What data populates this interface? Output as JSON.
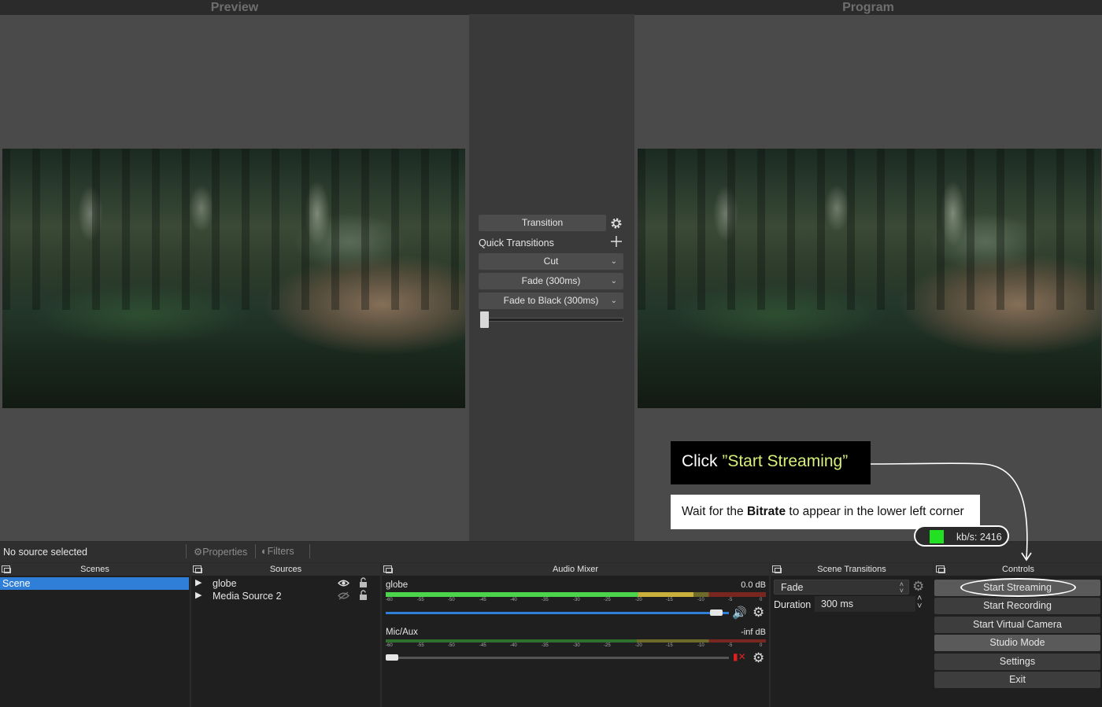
{
  "preview": {
    "title": "Preview"
  },
  "program": {
    "title": "Program"
  },
  "transition_panel": {
    "transition_label": "Transition",
    "quick_transitions_label": "Quick Transitions",
    "quick_items": [
      "Cut",
      "Fade (300ms)",
      "Fade to Black (300ms)"
    ],
    "tbar_position": 0
  },
  "status": {
    "no_source": "No source selected",
    "properties": "Properties",
    "filters": "Filters"
  },
  "scenes": {
    "title": "Scenes",
    "items": [
      "Scene"
    ],
    "selected": "Scene"
  },
  "sources": {
    "title": "Sources",
    "items": [
      {
        "name": "globe",
        "visible": true
      },
      {
        "name": "Media Source 2",
        "visible": false
      }
    ]
  },
  "audio_mixer": {
    "title": "Audio Mixer",
    "tick_labels": [
      "-60",
      "-55",
      "-50",
      "-45",
      "-40",
      "-35",
      "-30",
      "-25",
      "-20",
      "-15",
      "-10",
      "-5",
      "0"
    ],
    "channels": [
      {
        "name": "globe",
        "db": "0.0 dB",
        "volume_fraction": 0.98,
        "muted": false
      },
      {
        "name": "Mic/Aux",
        "db": "-inf dB",
        "volume_fraction": 0.0,
        "muted": true
      }
    ]
  },
  "scene_transitions": {
    "title": "Scene Transitions",
    "selected": "Fade",
    "duration_label": "Duration",
    "duration_value": "300 ms"
  },
  "controls": {
    "title": "Controls",
    "buttons": [
      "Start Streaming",
      "Start Recording",
      "Start Virtual Camera",
      "Studio Mode",
      "Settings",
      "Exit"
    ]
  },
  "annotation": {
    "click_prefix": "Click ",
    "click_highlight": "”Start Streaming”",
    "wait_prefix": "Wait for the ",
    "wait_bold": "Bitrate",
    "wait_suffix": " to appear in the lower left corner",
    "bitrate": "kb/s: 2416"
  },
  "colors": {
    "accent_selection": "#2f7fd8",
    "callout_highlight": "#d7f07a",
    "meter_green": "#4cd44c",
    "meter_yellow": "#c9b03a",
    "meter_red": "#c0392b",
    "bitrate_indicator": "#22e022"
  }
}
